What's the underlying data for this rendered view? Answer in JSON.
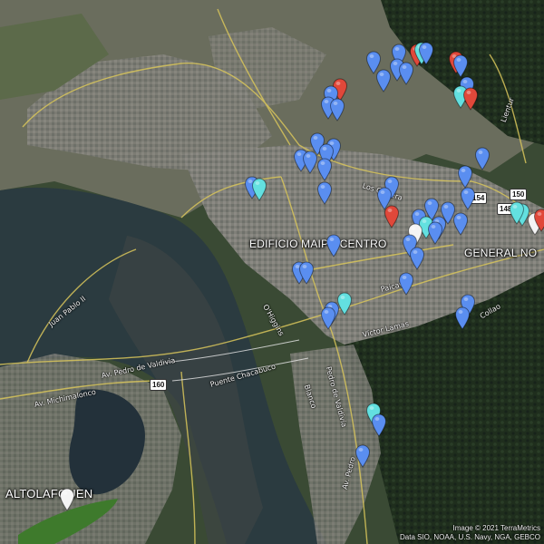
{
  "map": {
    "place_labels": {
      "edificio": "EDIFICIO MAIPU CENTRO",
      "general": "GENERAL NO",
      "altolafquen": "ALTOLAFQUEN"
    },
    "road_labels": {
      "juan_pablo": "Juan Pablo II",
      "pedro_valdivia": "Av. Pedro de Valdivia",
      "michimalonco": "Av. Michimalonco",
      "puente_chacabuco": "Puente Chacabuco",
      "los_carrera": "Los Carrera",
      "victor_lamas": "Víctor Lamas",
      "pedro_aguirre": "Pedro Aguirre Cerda",
      "ohiggins": "O'Higgins",
      "paicavi": "Paicaví",
      "blanco": "Blanco",
      "collao": "Collao",
      "lientur": "Lientur",
      "pedro_canal": "Pedro de Valdivia",
      "av_pedro_short": "Av. Pedro",
      "recto": "Recto"
    },
    "route_shields": {
      "r160": "160",
      "r154": "154",
      "r150": "150",
      "r148": "148"
    },
    "attribution": {
      "line1": "Image © 2021 TerraMetrics",
      "line2": "Data SIO, NOAA, U.S. Navy, NGA, GEBCO"
    },
    "colors": {
      "blue_marker": "#5a8ef0",
      "cyan_marker": "#63e0e0",
      "red_marker": "#e0483a",
      "white_marker": "#f4f4f4",
      "water": "#27363c",
      "urban": "#7b7c74",
      "forest": "#20301f"
    },
    "marker_icon": "map-pin-icon"
  }
}
